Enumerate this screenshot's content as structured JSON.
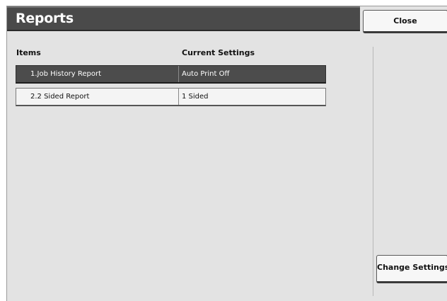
{
  "header": {
    "title": "Reports",
    "close_label": "Close"
  },
  "table": {
    "columns": {
      "items": "Items",
      "current_settings": "Current Settings"
    },
    "rows": [
      {
        "item": "1.Job History Report",
        "value": "Auto Print Off",
        "selected": true
      },
      {
        "item": "2.2 Sided Report",
        "value": "1 Sided",
        "selected": false
      }
    ]
  },
  "actions": {
    "change_settings_label": "Change Settings"
  }
}
